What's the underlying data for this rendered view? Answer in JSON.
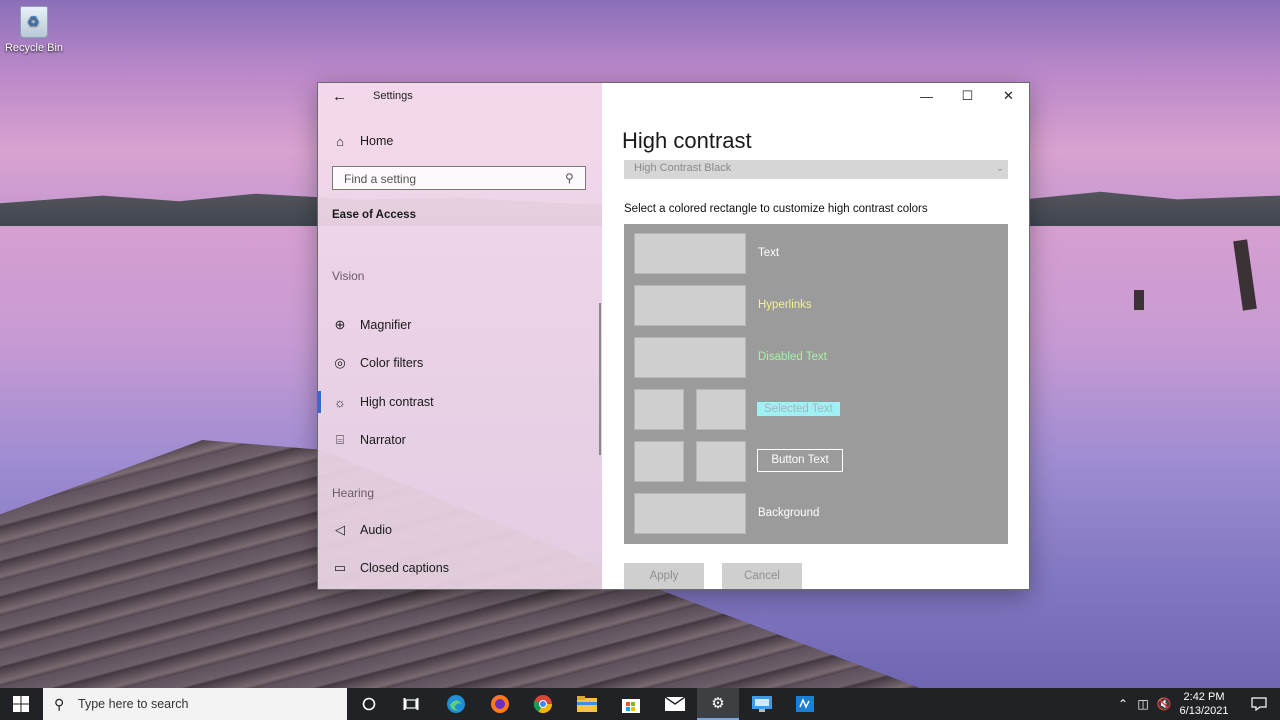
{
  "desktop": {
    "recycle_bin_label": "Recycle Bin"
  },
  "window": {
    "title": "Settings",
    "back_icon": "back-arrow-icon",
    "controls": {
      "minimize": "—",
      "maximize": "☐",
      "close": "✕"
    }
  },
  "sidebar": {
    "home_label": "Home",
    "search_placeholder": "Find a setting",
    "section_title": "Ease of Access",
    "groups": {
      "vision": "Vision",
      "hearing": "Hearing"
    },
    "items": [
      {
        "label": "Magnifier",
        "icon": "magnifier-icon",
        "glyph": "⊕"
      },
      {
        "label": "Color filters",
        "icon": "color-filters-icon",
        "glyph": "◎"
      },
      {
        "label": "High contrast",
        "icon": "high-contrast-icon",
        "glyph": "☼"
      },
      {
        "label": "Narrator",
        "icon": "narrator-icon",
        "glyph": "⌸"
      },
      {
        "label": "Audio",
        "icon": "audio-icon",
        "glyph": "◁"
      },
      {
        "label": "Closed captions",
        "icon": "closed-captions-icon",
        "glyph": "▭"
      }
    ],
    "active_item": "High contrast",
    "accent_color": "#2d6fc7"
  },
  "main": {
    "page_title": "High contrast",
    "theme_value": "High Contrast Black",
    "instruction": "Select a colored rectangle to customize high contrast colors",
    "preview": {
      "background_color": "#9b9b9b",
      "rows": [
        {
          "label": "Text",
          "color": "#ffffff"
        },
        {
          "label": "Hyperlinks",
          "color": "#f4f09a"
        },
        {
          "label": "Disabled Text",
          "color": "#a8f0a8"
        },
        {
          "label": "Selected Text",
          "color": "#9fb8bd",
          "highlight": "#9ff1f5"
        },
        {
          "label": "Button Text",
          "color": "#ffffff"
        },
        {
          "label": "Background",
          "color": "#ffffff"
        }
      ]
    },
    "buttons": {
      "apply": "Apply",
      "cancel": "Cancel"
    }
  },
  "taskbar": {
    "search_placeholder": "Type here to search",
    "apps": [
      "cortana-icon",
      "task-view-icon",
      "edge-icon",
      "firefox-icon",
      "chrome-icon",
      "file-explorer-icon",
      "store-icon",
      "mail-icon",
      "settings-icon",
      "remote-desktop-icon",
      "app-icon"
    ],
    "time": "2:42 PM",
    "date": "6/13/2021"
  }
}
